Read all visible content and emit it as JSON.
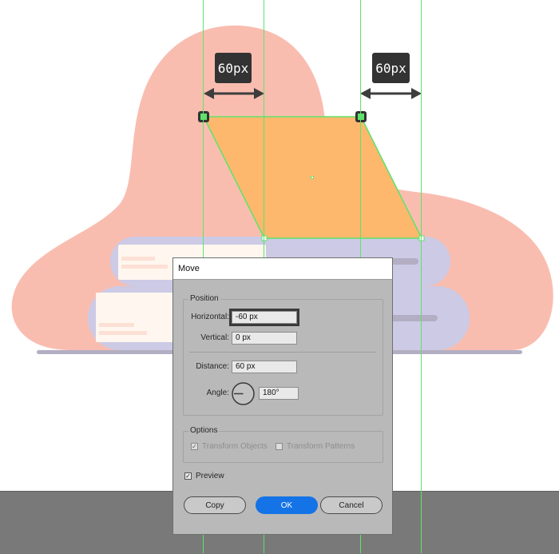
{
  "canvas": {
    "dimension_labels": [
      "60px",
      "60px"
    ],
    "colors": {
      "blob": "#f9bdb0",
      "parallelogram": "#fdb86d",
      "book_cover": "#cccae5",
      "book_pages": "#fff7ef",
      "book_lines": "#fde0d5",
      "shadow": "#b3aec3",
      "guide": "#5ee36a",
      "workspace": "#797979"
    }
  },
  "dialog": {
    "title": "Move",
    "position_group": "Position",
    "horizontal_label": "Horizontal:",
    "horizontal_value": "-60 px",
    "vertical_label": "Vertical:",
    "vertical_value": "0 px",
    "distance_label": "Distance:",
    "distance_value": "60 px",
    "angle_label": "Angle:",
    "angle_value": "180°",
    "options_group": "Options",
    "transform_objects": "Transform Objects",
    "transform_patterns": "Transform Patterns",
    "preview": "Preview",
    "copy_button": "Copy",
    "ok_button": "OK",
    "cancel_button": "Cancel"
  }
}
